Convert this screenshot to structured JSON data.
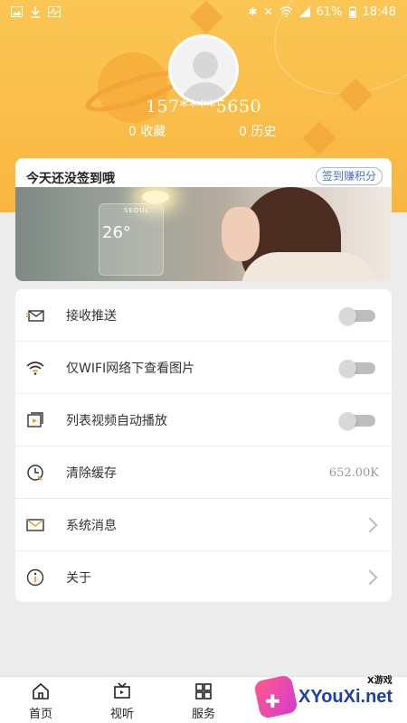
{
  "status_bar": {
    "battery": "61%",
    "time": "18:48",
    "icons": [
      "image-icon",
      "download-icon",
      "activity-icon",
      "bluetooth-icon",
      "mute-icon",
      "wifi-icon",
      "signal-icon",
      "battery-icon"
    ]
  },
  "profile": {
    "phone": "157****5650",
    "favorites": "0 收藏",
    "history": "0 历史"
  },
  "sign_in": {
    "title": "今天还没签到哦",
    "button": "签到赚积分",
    "banner_temp": "26°",
    "banner_city": "SEOUL"
  },
  "settings": {
    "items": [
      {
        "label": "接收推送",
        "icon": "envelope-push-icon",
        "control": "toggle"
      },
      {
        "label": "仅WIFI网络下查看图片",
        "icon": "wifi-icon",
        "control": "toggle"
      },
      {
        "label": "列表视频自动播放",
        "icon": "video-play-icon",
        "control": "toggle"
      },
      {
        "label": "清除缓存",
        "icon": "clock-clear-icon",
        "value": "652.00K"
      },
      {
        "label": "系统消息",
        "icon": "mail-icon",
        "control": "chevron"
      },
      {
        "label": "关于",
        "icon": "info-icon",
        "control": "chevron"
      }
    ]
  },
  "tabbar": {
    "tabs": [
      {
        "label": "首页",
        "icon": "home-icon"
      },
      {
        "label": "视听",
        "icon": "tv-icon"
      },
      {
        "label": "服务",
        "icon": "grid-icon"
      }
    ]
  },
  "watermark": {
    "small": "X游戏",
    "text": "XYouXi.net"
  },
  "colors": {
    "header": "#f8b640",
    "link": "#4a6fc1"
  }
}
